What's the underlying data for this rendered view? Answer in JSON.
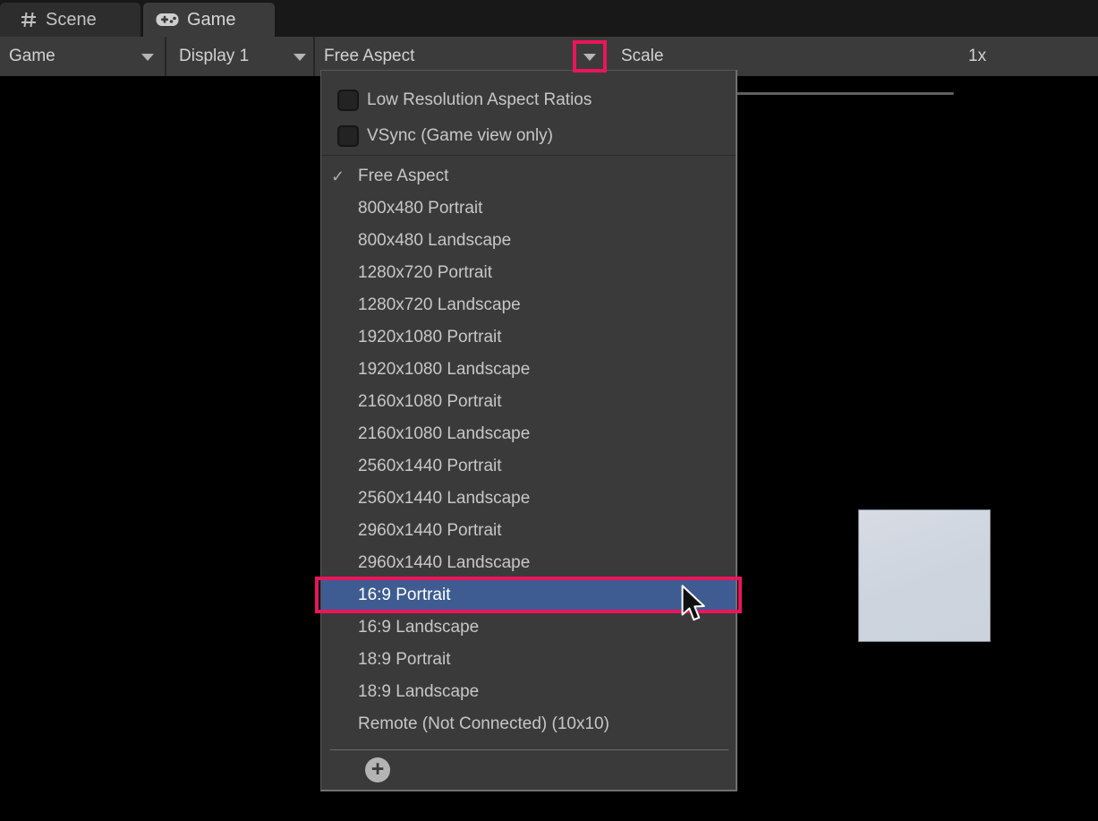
{
  "window": {
    "tabs": [
      {
        "label": "Scene",
        "active": false,
        "icon": "grid-icon"
      },
      {
        "label": "Game",
        "active": true,
        "icon": "gamepad-icon"
      }
    ]
  },
  "toolbar": {
    "game_menu_label": "Game",
    "display_menu_label": "Display 1",
    "aspect_menu_label": "Free Aspect",
    "scale_label": "Scale",
    "scale_value": "1x",
    "scale_slider_position": "minimum"
  },
  "aspect_menu": {
    "checkboxes": [
      {
        "label": "Low Resolution Aspect Ratios",
        "checked": false
      },
      {
        "label": "VSync (Game view only)",
        "checked": false
      }
    ],
    "items": [
      {
        "label": "Free Aspect",
        "checked": true
      },
      {
        "label": "800x480 Portrait"
      },
      {
        "label": "800x480 Landscape"
      },
      {
        "label": "1280x720 Portrait"
      },
      {
        "label": "1280x720 Landscape"
      },
      {
        "label": "1920x1080 Portrait"
      },
      {
        "label": "1920x1080 Landscape"
      },
      {
        "label": "2160x1080 Portrait"
      },
      {
        "label": "2160x1080 Landscape"
      },
      {
        "label": "2560x1440 Portrait"
      },
      {
        "label": "2560x1440 Landscape"
      },
      {
        "label": "2960x1440 Portrait"
      },
      {
        "label": "2960x1440 Landscape"
      },
      {
        "label": "16:9 Portrait",
        "highlighted": true
      },
      {
        "label": "16:9 Landscape"
      },
      {
        "label": "18:9 Portrait"
      },
      {
        "label": "18:9 Landscape"
      },
      {
        "label": "Remote (Not Connected) (10x10)"
      }
    ],
    "add_button_glyph": "+",
    "check_glyph": "✓"
  },
  "icons": {
    "scene_tab": "grid-icon",
    "game_tab": "gamepad-icon",
    "dropdown_arrows": "chevron-down-icon",
    "add_aspect": "plus-circle-icon",
    "selected_item": "checkmark-icon",
    "pointer": "mouse-cursor"
  },
  "colors": {
    "accent_pink": "#ea155c",
    "selection_blue": "#3e5c91",
    "toolbar_bg": "#3b3b3b",
    "panel_bg": "#3a3a3a",
    "game_view_bg": "#000000",
    "square_fill": "#ced4de"
  }
}
